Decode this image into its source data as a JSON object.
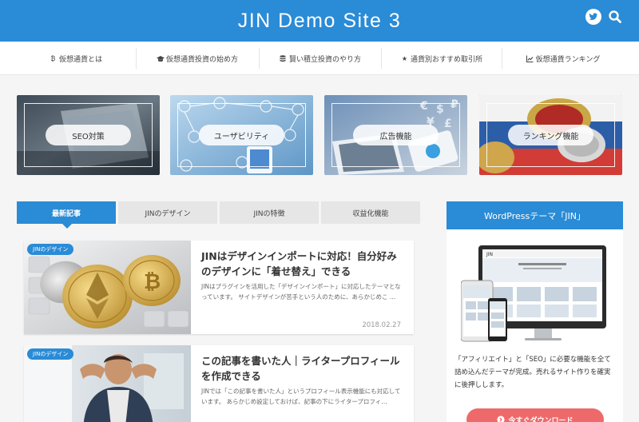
{
  "header": {
    "title": "JIN Demo Site 3",
    "twitter_icon": "twitter-icon",
    "search_icon": "search-icon"
  },
  "nav": {
    "items": [
      {
        "label": "仮想通貨とは",
        "icon": "bitcoin-icon"
      },
      {
        "label": "仮想通貨投資の始め方",
        "icon": "graduation-cap-icon"
      },
      {
        "label": "賢い積立投資のやり方",
        "icon": "database-icon"
      },
      {
        "label": "通貨別おすすめ取引所",
        "icon": "star-icon"
      },
      {
        "label": "仮想通貨ランキング",
        "icon": "chart-icon"
      }
    ]
  },
  "features": [
    {
      "label": "SEO対策"
    },
    {
      "label": "ユーザビリティ"
    },
    {
      "label": "広告機能"
    },
    {
      "label": "ランキング機能"
    }
  ],
  "tabs": [
    {
      "label": "最新記事"
    },
    {
      "label": "JINのデザイン"
    },
    {
      "label": "JINの特徴"
    },
    {
      "label": "収益化機能"
    }
  ],
  "posts": [
    {
      "category": "JINのデザイン",
      "title": "JINはデザインインポートに対応！自分好みのデザインに「着せ替え」できる",
      "excerpt": "JINはプラグインを活用した「デザインインポート」に対応したテーマとなっています。 サイトデザインが苦手という人のために、あらかじめこ …",
      "date": "2018.02.27"
    },
    {
      "category": "JINのデザイン",
      "title": "この記事を書いた人｜ライタープロフィールを作成できる",
      "excerpt": "JINでは「この記事を書いた人」というプロフィール表示機能にも対応しています。 あらかじめ設定しておけば、記事の下にライタープロフィ…",
      "date": ""
    }
  ],
  "sidebar": {
    "title": "WordPressテーマ「JIN」",
    "text": "「アフィリエイト」と「SEO」に必要な機能を全て詰め込んだテーマが完成。売れるサイト作りを確実に後押しします。",
    "button_label": "今すぐダウンロード",
    "mockup_brand": "JIN"
  },
  "colors": {
    "accent": "#2a8bd6",
    "button": "#ee6a6a",
    "background": "#f5f5f5"
  }
}
